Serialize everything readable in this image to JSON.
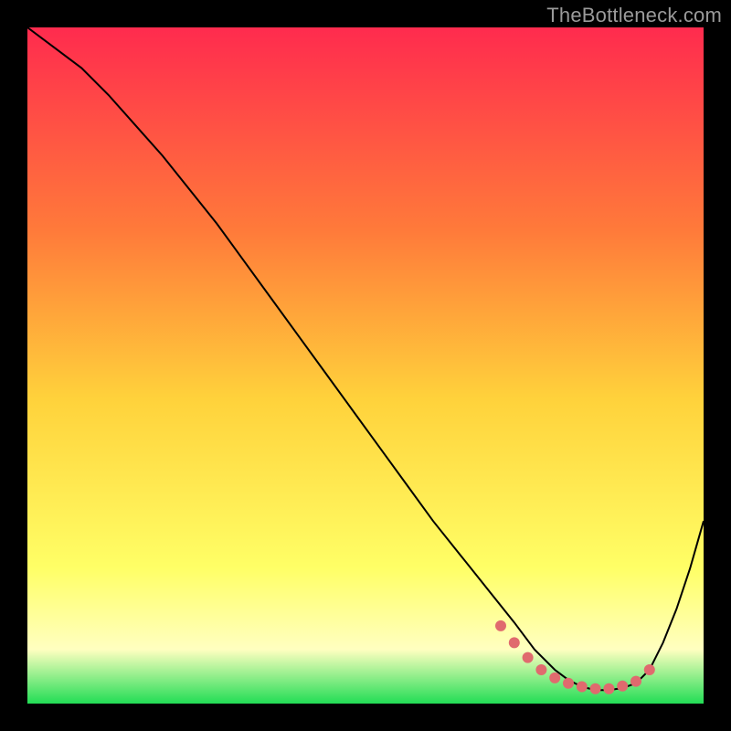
{
  "watermark": "TheBottleneck.com",
  "chart_data": {
    "type": "line",
    "title": "",
    "xlabel": "",
    "ylabel": "",
    "xlim": [
      0,
      100
    ],
    "ylim": [
      0,
      100
    ],
    "grid": false,
    "legend": false,
    "gradient": {
      "top": "#ff2b4e",
      "mid_upper": "#ff7a3a",
      "mid": "#ffd23b",
      "mid_lower": "#ffff66",
      "pale": "#ffffc0",
      "bottom": "#22dd55"
    },
    "series": [
      {
        "name": "main-curve",
        "color": "#000000",
        "type": "line",
        "x": [
          0,
          4,
          8,
          12,
          16,
          20,
          24,
          28,
          32,
          36,
          40,
          44,
          48,
          52,
          56,
          60,
          64,
          68,
          72,
          75,
          78,
          80,
          82,
          84,
          86,
          88,
          90,
          92,
          94,
          96,
          98,
          100
        ],
        "y": [
          100,
          97,
          94,
          90,
          85.5,
          81,
          76,
          71,
          65.5,
          60,
          54.5,
          49,
          43.5,
          38,
          32.5,
          27,
          22,
          17,
          12,
          8,
          5,
          3.5,
          2.5,
          2.0,
          2.0,
          2.3,
          3.0,
          5.0,
          9.0,
          14,
          20,
          27
        ]
      },
      {
        "name": "bottom-marker-band",
        "color": "#e06a6e",
        "type": "scatter",
        "x": [
          70,
          72,
          74,
          76,
          78,
          80,
          82,
          84,
          86,
          88,
          90,
          92
        ],
        "y": [
          11.5,
          9.0,
          6.8,
          5.0,
          3.8,
          3.0,
          2.5,
          2.2,
          2.2,
          2.6,
          3.3,
          5.0
        ]
      }
    ]
  }
}
